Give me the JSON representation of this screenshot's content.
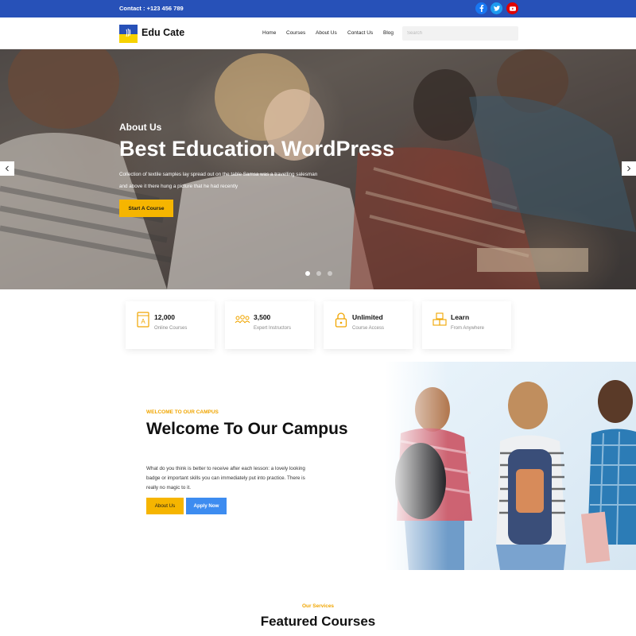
{
  "topbar": {
    "contact": "Contact : +123 456 789",
    "social": [
      "facebook-icon",
      "twitter-icon",
      "youtube-icon"
    ]
  },
  "header": {
    "logo": "Edu Cate",
    "nav": [
      "Home",
      "Courses",
      "About Us",
      "Contact Us",
      "Blog"
    ],
    "search_placeholder": "Search"
  },
  "hero": {
    "subtitle": "About Us",
    "title": "Best Education WordPress",
    "description": "Collection of textile samples lay spread out on the table Samsa was a travelling salesman and above it there hung a picture that he had recently",
    "button": "Start A Course",
    "slide_count": 3,
    "active_slide": 1
  },
  "features": [
    {
      "value": "12,000",
      "label": "Online Courses",
      "icon": "book-icon"
    },
    {
      "value": "3,500",
      "label": "Expert Instructors",
      "icon": "users-icon"
    },
    {
      "value": "Unlimited",
      "label": "Course Access",
      "icon": "lock-icon"
    },
    {
      "value": "Learn",
      "label": "From Anywhere",
      "icon": "boxes-icon"
    }
  ],
  "welcome": {
    "eyebrow": "WELCOME TO OUR CAMPUS",
    "title": "Welcome To Our Campus",
    "description": "What do you think is better to receive after each lesson: a lovely looking badge or important skills you can immediately put into practice. There is really no magic to it.",
    "btn_about": "About Us",
    "btn_apply": "Apply Now"
  },
  "services": {
    "eyebrow": "Our Services",
    "title": "Featured Courses"
  },
  "colors": {
    "topbar": "#2751b8",
    "accent": "#f6b500",
    "primary": "#3d8cf0"
  }
}
